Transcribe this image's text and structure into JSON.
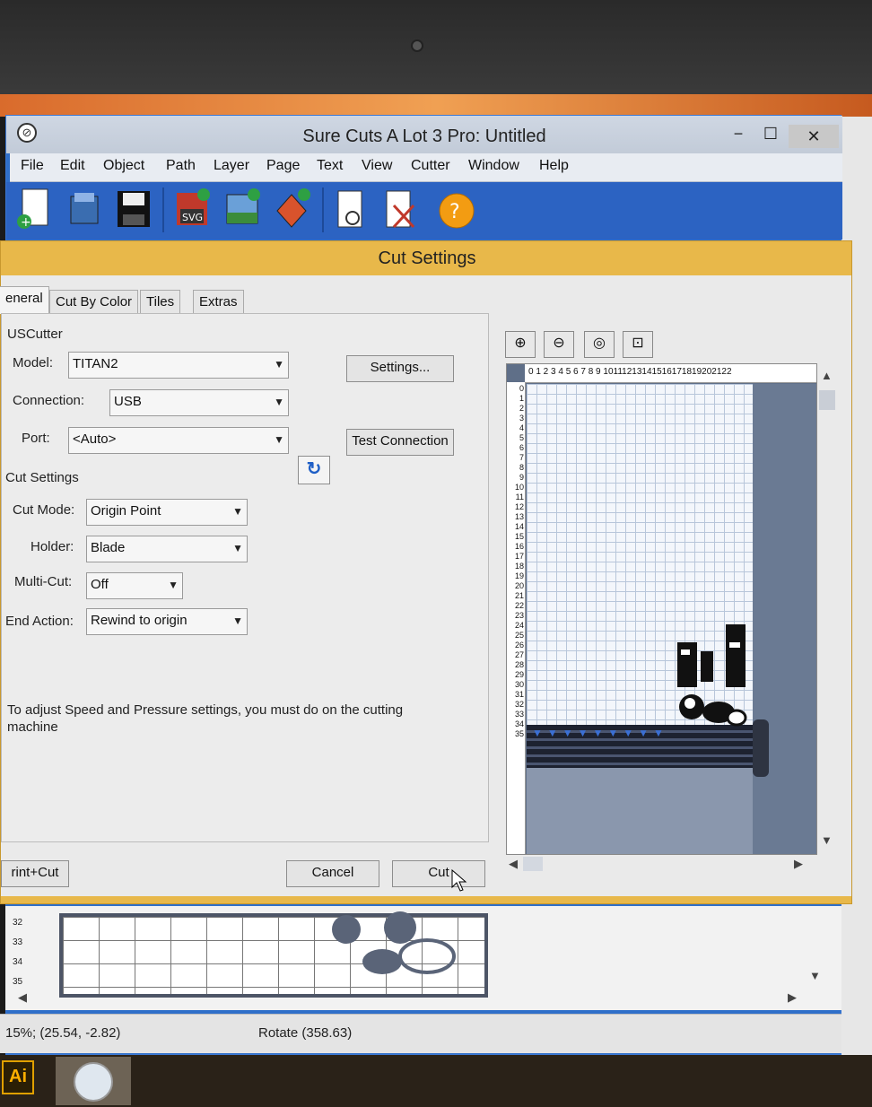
{
  "window": {
    "title": "Sure Cuts A Lot 3 Pro: Untitled",
    "minimize": "−",
    "maximize": "☐",
    "close": "✕"
  },
  "menu": [
    "File",
    "Edit",
    "Object",
    "Path",
    "Layer",
    "Page",
    "Text",
    "View",
    "Cutter",
    "Window",
    "Help"
  ],
  "toolbar_icons": [
    "new-document-icon",
    "open-icon",
    "save-icon",
    "import-svg-icon",
    "import-image-icon",
    "trace-icon",
    "preview-icon",
    "cut-icon",
    "help-icon"
  ],
  "toolbar": {
    "svg_label": "SVG",
    "help_glyph": "?"
  },
  "dialog": {
    "title": "Cut Settings",
    "tabs": [
      "eneral",
      "Cut By Color",
      "Tiles",
      "Extras"
    ],
    "cutter_section": "USCutter",
    "model_label": "Model:",
    "model_value": "TITAN2",
    "connection_label": "Connection:",
    "connection_value": "USB",
    "port_label": "Port:",
    "port_value": "<Auto>",
    "settings_button": "Settings...",
    "test_connection_button": "Test Connection",
    "cut_settings_section": "Cut Settings",
    "cut_mode_label": "Cut Mode:",
    "cut_mode_value": "Origin Point",
    "holder_label": "Holder:",
    "holder_value": "Blade",
    "multicut_label": "Multi-Cut:",
    "multicut_value": "Off",
    "end_action_label": "End Action:",
    "end_action_value": "Rewind to origin",
    "info": "To adjust Speed and Pressure settings, you must do on the cutting machine",
    "print_cut_button": "rint+Cut",
    "cancel_button": "Cancel",
    "cut_button": "Cut"
  },
  "preview": {
    "ruler_top": "0 1 2 3 4 5 6 7 8 9 10111213141516171819202122",
    "ruler_left": [
      "0",
      "1",
      "2",
      "3",
      "4",
      "5",
      "6",
      "7",
      "8",
      "9",
      "10",
      "11",
      "12",
      "13",
      "14",
      "15",
      "16",
      "17",
      "18",
      "19",
      "20",
      "21",
      "22",
      "23",
      "24",
      "25",
      "26",
      "27",
      "28",
      "29",
      "30",
      "31",
      "32",
      "33",
      "34",
      "35"
    ],
    "teeth": "▼▼▼▼▼▼▼▼▼"
  },
  "canvas_ruler": [
    "32",
    "33",
    "34",
    "35"
  ],
  "status": {
    "coords": "15%; (25.54, -2.82)",
    "rotate": "Rotate (358.63)"
  },
  "taskbar": {
    "ai_label": "Ai"
  }
}
